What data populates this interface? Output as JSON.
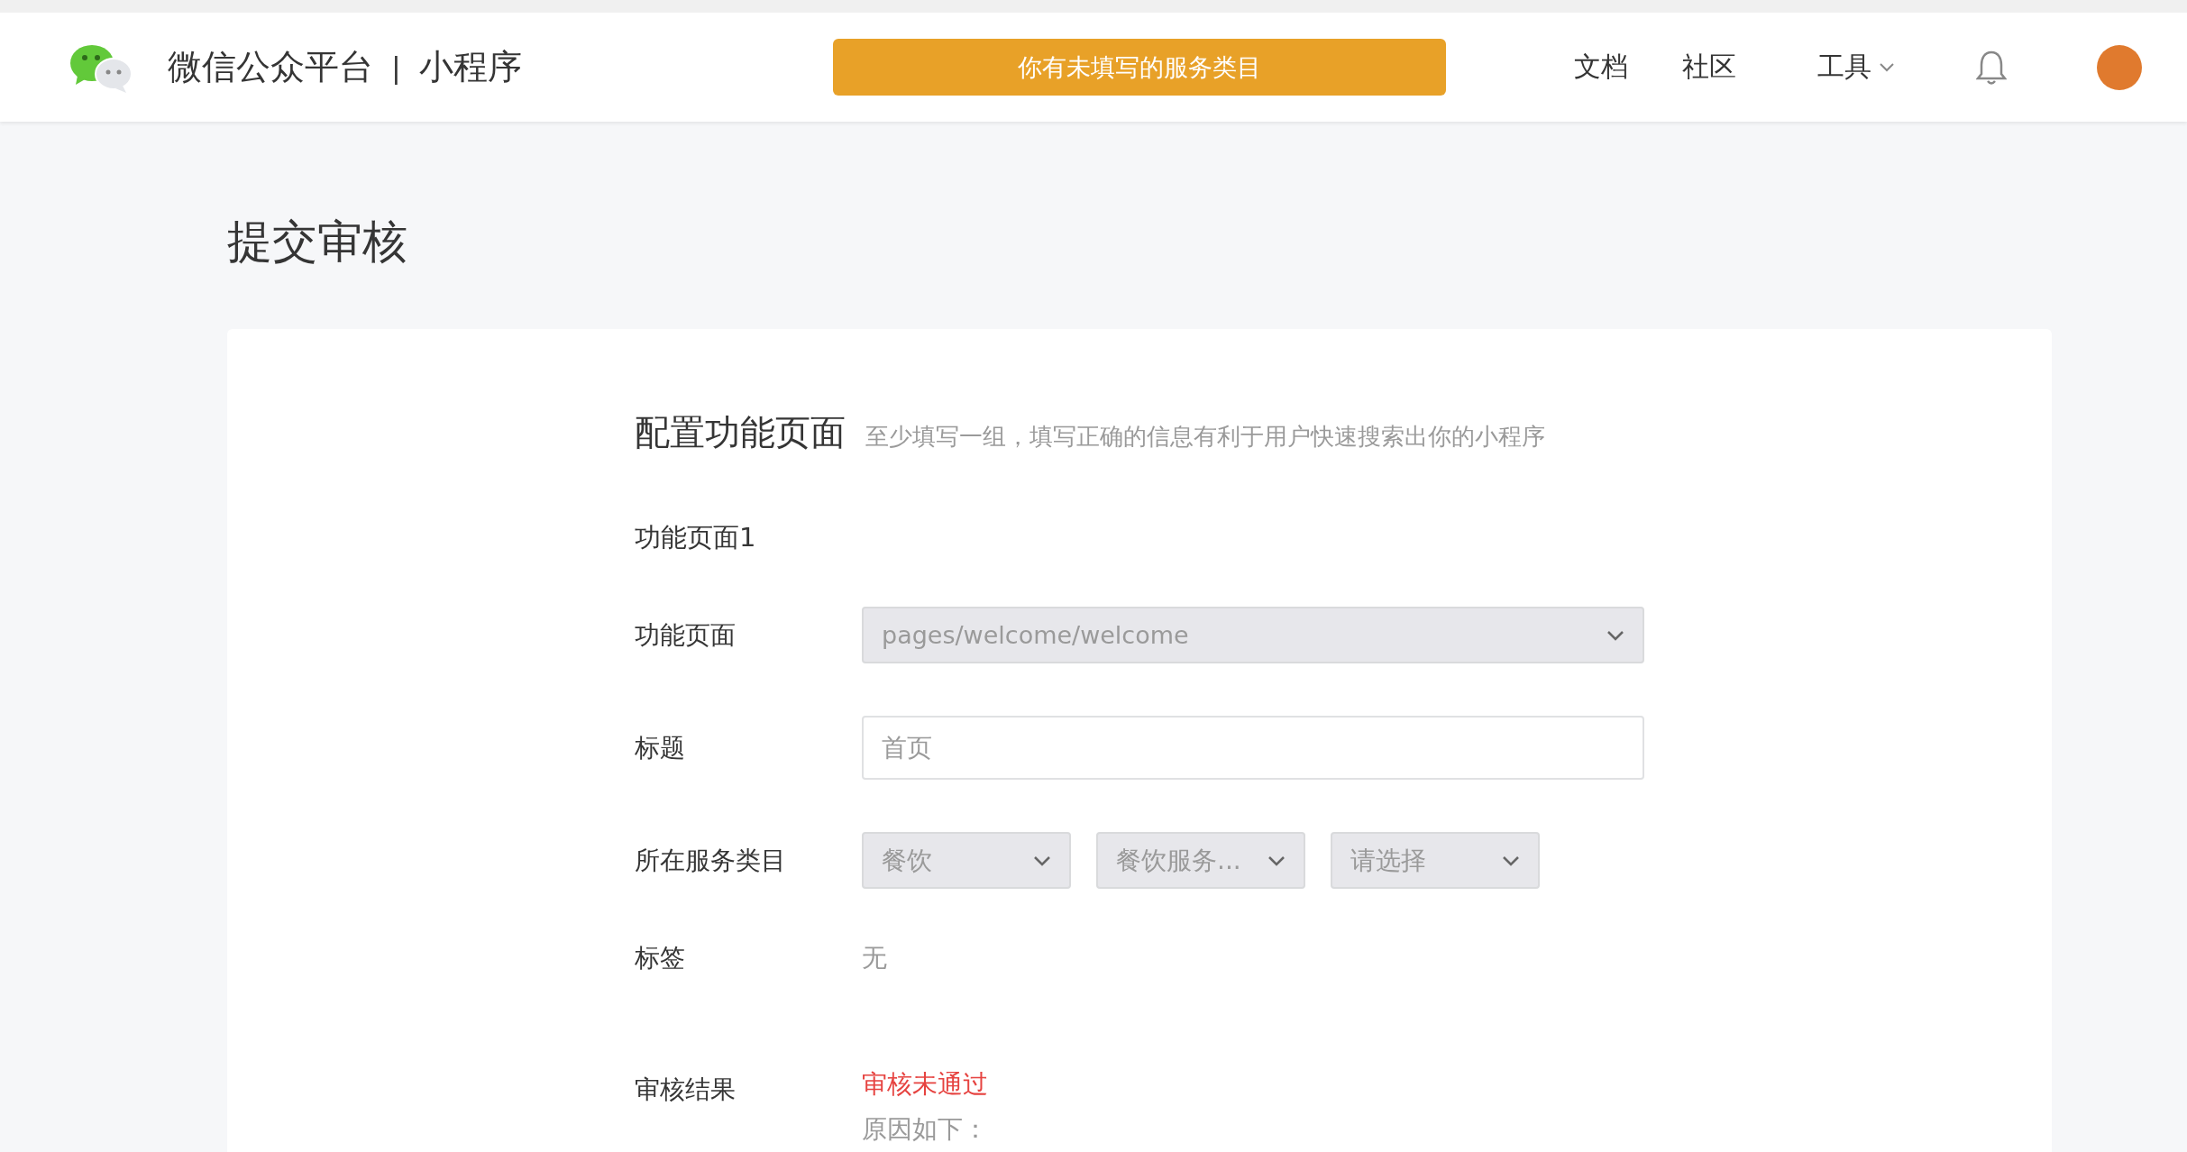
{
  "header": {
    "brand": "微信公众平台",
    "separator": "|",
    "product": "小程序",
    "notice": "你有未填写的服务类目",
    "nav": [
      {
        "label": "文档",
        "kind": "link"
      },
      {
        "label": "社区",
        "kind": "link"
      },
      {
        "label": "工具",
        "kind": "dropdown"
      }
    ]
  },
  "page_title": "提交审核",
  "section": {
    "title": "配置功能页面",
    "hint": "至少填写一组，填写正确的信息有利于用户快速搜索出你的小程序",
    "group_title": "功能页面1",
    "fields": [
      {
        "label": "功能页面",
        "kind": "select",
        "selects": [
          {
            "value": "pages/welcome/welcome",
            "disabled": true
          }
        ]
      },
      {
        "label": "标题",
        "kind": "input",
        "placeholder": "首页"
      },
      {
        "label": "所在服务类目",
        "kind": "selects",
        "selects": [
          {
            "value": "餐饮",
            "disabled": true
          },
          {
            "value": "餐饮服务...",
            "disabled": true
          },
          {
            "value": "请选择",
            "disabled": true
          }
        ]
      },
      {
        "label": "标签",
        "kind": "text",
        "value": "无"
      },
      {
        "label": "审核结果",
        "kind": "status",
        "value": "审核未通过",
        "note": "原因如下："
      }
    ]
  }
}
